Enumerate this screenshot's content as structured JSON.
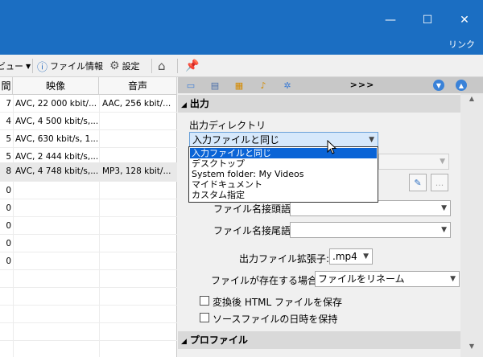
{
  "window": {
    "minimize_glyph": "—",
    "maximize_glyph": "☐",
    "close_glyph": "✕",
    "menu_link": "リンク"
  },
  "toolbar": {
    "view_label": "ビュー",
    "file_info_label": "ファイル情報",
    "settings_label": "設定"
  },
  "list": {
    "headers": {
      "time": "間",
      "video": "映像",
      "audio": "音声"
    },
    "rows": [
      {
        "time": "7",
        "video": "AVC, 22 000 kbit/...",
        "audio": "AAC, 256 kbit/..."
      },
      {
        "time": "4",
        "video": "AVC, 4 500 kbit/s,...",
        "audio": ""
      },
      {
        "time": "5",
        "video": "AVC, 630 kbit/s, 1...",
        "audio": ""
      },
      {
        "time": "5",
        "video": "AVC, 2 444 kbit/s,...",
        "audio": ""
      },
      {
        "time": "8",
        "video": "AVC, 4 748 kbit/s,...",
        "audio": "MP3, 128 kbit/..."
      },
      {
        "time": "0",
        "video": "",
        "audio": ""
      },
      {
        "time": "0",
        "video": "",
        "audio": ""
      },
      {
        "time": "0",
        "video": "",
        "audio": ""
      },
      {
        "time": "0",
        "video": "",
        "audio": ""
      },
      {
        "time": "0",
        "video": "",
        "audio": ""
      }
    ]
  },
  "tabs": {
    "more_label": ">>>"
  },
  "output": {
    "section_title": "出力",
    "dir_label": "出力ディレクトリ",
    "dir_selected": "入力ファイルと同じ",
    "dir_options": [
      "入力ファイルと同じ",
      "デスクトップ",
      "System folder: My Videos",
      "マイドキュメント",
      "カスタム指定"
    ],
    "prefix_label": "ファイル名接頭語:",
    "suffix_label": "ファイル名接尾語:",
    "ext_label": "出力ファイル拡張子:",
    "ext_value": ".mp4",
    "exists_label": "ファイルが存在する場合:",
    "exists_value": "ファイルをリネーム",
    "save_html_label": "変換後 HTML ファイルを保存",
    "keep_date_label": "ソースファイルの日時を保持",
    "browse_label": "..."
  },
  "profile": {
    "section_title": "プロファイル"
  }
}
